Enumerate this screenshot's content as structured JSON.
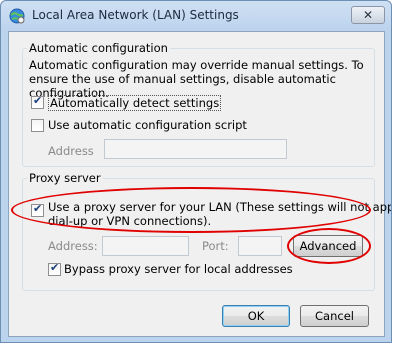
{
  "window": {
    "title": "Local Area Network (LAN) Settings",
    "close_glyph": "✕"
  },
  "auto_config": {
    "legend": "Automatic configuration",
    "description": "Automatic configuration may override manual settings.  To ensure the use of manual settings, disable automatic configuration.",
    "detect_label": "Automatically detect settings",
    "detect_checked": true,
    "script_label": "Use automatic configuration script",
    "script_checked": false,
    "address_label": "Address",
    "address_value": ""
  },
  "proxy": {
    "legend": "Proxy server",
    "use_proxy_label_line1": "Use a proxy server for your LAN (These settings will not apply to",
    "use_proxy_label_line2": "dial-up or VPN connections).",
    "use_proxy_checked": true,
    "address_label": "Address:",
    "address_value": "",
    "port_label": "Port:",
    "port_value": "",
    "advanced_label": "Advanced",
    "bypass_label": "Bypass proxy server for local addresses",
    "bypass_checked": true
  },
  "buttons": {
    "ok": "OK",
    "cancel": "Cancel"
  },
  "highlight_color": "#e00000"
}
